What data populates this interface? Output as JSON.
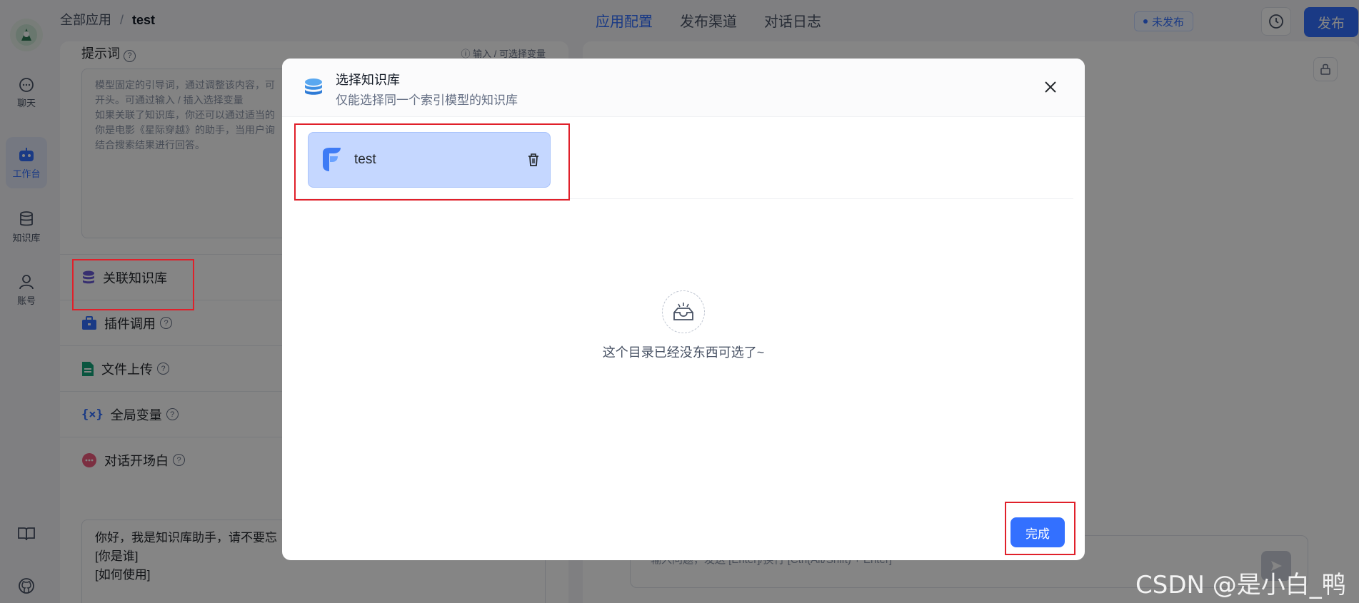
{
  "breadcrumb": {
    "root": "全部应用",
    "separator": "/",
    "current": "test"
  },
  "tabs": [
    {
      "label": "应用配置",
      "active": true
    },
    {
      "label": "发布渠道",
      "active": false
    },
    {
      "label": "对话日志",
      "active": false
    }
  ],
  "status_badge": "未发布",
  "publish_label": "发布",
  "sidebar": {
    "items": [
      {
        "label": "聊天",
        "icon": "chat-icon",
        "active": false
      },
      {
        "label": "工作台",
        "icon": "robot-icon",
        "active": true
      },
      {
        "label": "知识库",
        "icon": "database-icon",
        "active": false
      },
      {
        "label": "账号",
        "icon": "user-icon",
        "active": false
      }
    ],
    "bottom": [
      {
        "icon": "book-icon"
      },
      {
        "icon": "github-icon"
      }
    ]
  },
  "config": {
    "prompt_label": "提示词",
    "prompt_hint": "输入 / 可选择变量",
    "prompt_placeholder": "模型固定的引导词，通过调整该内容，可\n开头。可通过输入 / 插入选择变量\n如果关联了知识库，你还可以通过适当的\n你是电影《星际穿越》的助手，当用户询\n结合搜索结果进行回答。",
    "sections": [
      {
        "label": "关联知识库",
        "icon": "database-icon",
        "help": false
      },
      {
        "label": "插件调用",
        "icon": "toolbox-icon",
        "help": true
      },
      {
        "label": "文件上传",
        "icon": "file-icon",
        "help": true
      },
      {
        "label": "全局变量",
        "icon": "variable-icon",
        "help": true
      },
      {
        "label": "对话开场白",
        "icon": "chat-bubble-icon",
        "help": true
      }
    ],
    "greeting": "你好，我是知识库助手，请不要忘\n[你是谁]\n[如何使用]"
  },
  "preview": {
    "input_placeholder": "输入问题，发送 [Enter]/换行 [Ctrl(Alt/Shift) + Enter]"
  },
  "modal": {
    "title": "选择知识库",
    "subtitle": "仅能选择同一个索引模型的知识库",
    "selected": [
      {
        "name": "test"
      }
    ],
    "empty_text": "这个目录已经没东西可选了~",
    "done_label": "完成"
  },
  "watermark": "CSDN @是小白_鸭",
  "colors": {
    "accent": "#3370ff",
    "annotation": "#e0202a"
  }
}
